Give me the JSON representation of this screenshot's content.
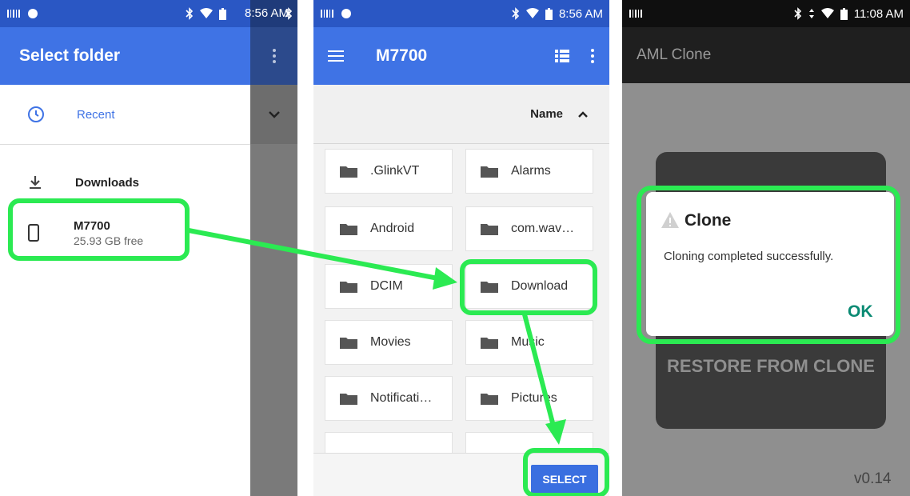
{
  "panel1": {
    "status_time": "8:56 AM",
    "title": "Select folder",
    "items": [
      {
        "label": "Recent",
        "icon": "clock-icon"
      },
      {
        "label": "Downloads",
        "icon": "download-icon"
      },
      {
        "label": "M7700",
        "sub": "25.93 GB free",
        "icon": "phone-icon"
      }
    ]
  },
  "panel2": {
    "status_time": "8:56 AM",
    "title": "M7700",
    "sort_label": "Name",
    "folders": [
      ".GlinkVT",
      "Alarms",
      "Android",
      "com.wav…",
      "DCIM",
      "Download",
      "Movies",
      "Music",
      "Notificati…",
      "Pictures"
    ],
    "select_label": "SELECT"
  },
  "panel3": {
    "status_time": "11:08 AM",
    "app_title": "AML Clone",
    "restore_label": "RESTORE FROM CLONE",
    "dialog": {
      "title": "Clone",
      "message": "Cloning completed successfully.",
      "ok_label": "OK"
    },
    "version": "v0.14"
  },
  "colors": {
    "highlight": "#2bea52",
    "appbar_blue": "#3f73e5",
    "ok_teal": "#0a8a73"
  }
}
